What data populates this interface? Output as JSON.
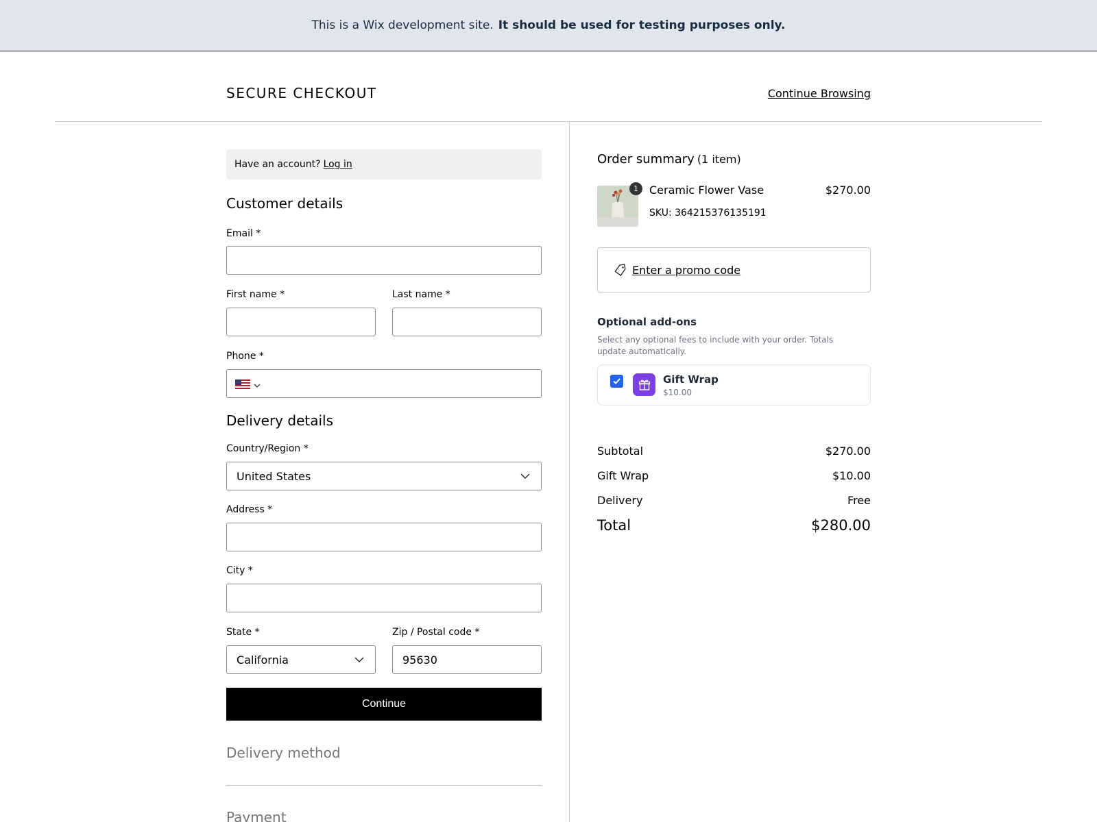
{
  "banner": {
    "text_regular": "This is a Wix development site.",
    "text_bold": "It should be used for testing purposes only."
  },
  "header": {
    "title": "SECURE CHECKOUT",
    "continue_label": "Continue Browsing"
  },
  "account": {
    "prompt": "Have an account?",
    "login_label": "Log in"
  },
  "customer": {
    "title": "Customer details",
    "email_label": "Email *",
    "email_value": "",
    "first_name_label": "First name *",
    "first_name_value": "",
    "last_name_label": "Last name *",
    "last_name_value": "",
    "phone_label": "Phone *",
    "phone_value": "",
    "phone_country_icon": "us-flag-icon"
  },
  "delivery": {
    "title": "Delivery details",
    "country_label": "Country/Region *",
    "country_value": "United States",
    "address_label": "Address *",
    "address_value": "",
    "city_label": "City *",
    "city_value": "",
    "state_label": "State *",
    "state_value": "California",
    "zip_label": "Zip / Postal code *",
    "zip_value": "95630",
    "continue_label": "Continue"
  },
  "steps": {
    "delivery_method": "Delivery method",
    "payment": "Payment"
  },
  "summary": {
    "title": "Order summary",
    "count": "(1 item)",
    "item": {
      "quantity": "1",
      "name": "Ceramic Flower Vase",
      "price": "$270.00",
      "sku": "SKU: 364215376135191"
    },
    "promo_label": "Enter a promo code",
    "addons_title": "Optional add-ons",
    "addons_desc": "Select any optional fees to include with your order. Totals update automatically.",
    "addon": {
      "name": "Gift Wrap",
      "price": "$10.00",
      "checked": true
    },
    "subtotal_label": "Subtotal",
    "subtotal_value": "$270.00",
    "giftwrap_label": "Gift Wrap",
    "giftwrap_value": "$10.00",
    "delivery_label": "Delivery",
    "delivery_value": "Free",
    "total_label": "Total",
    "total_value": "$280.00"
  },
  "colors": {
    "banner_bg": "#e1e5ed",
    "primary_button": "#000000",
    "checkbox": "#2563eb",
    "gift_tile": "#7b3fe4"
  }
}
